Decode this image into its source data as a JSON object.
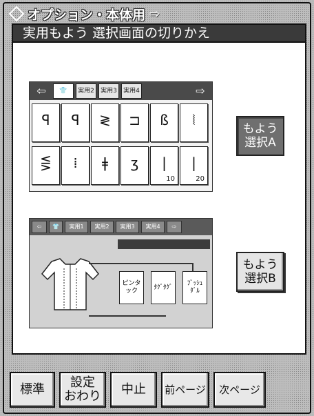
{
  "header": {
    "title": "オプション・本体用",
    "title_arrow_icon": "right-arrow-icon",
    "subtitle": "実用もよう 選択画面の切りかえ"
  },
  "preview_a": {
    "tabs": [
      "",
      "実用2",
      "実用3",
      "実用4"
    ],
    "stitches": [
      {
        "icon": "buttonhole-icon",
        "glyph": "ꟼ"
      },
      {
        "icon": "buttonhole-icon",
        "glyph": "ꟼ"
      },
      {
        "icon": "zigzag-stitch-icon",
        "glyph": "≷"
      },
      {
        "icon": "blind-stitch-icon",
        "glyph": "⊐"
      },
      {
        "icon": "overcast-stitch-icon",
        "glyph": "ß"
      },
      {
        "icon": "triple-zigzag-icon",
        "glyph": "⦚"
      },
      {
        "icon": "scallop-stitch-icon",
        "glyph": "⋚"
      },
      {
        "icon": "dotted-stitch-icon",
        "glyph": "⁞"
      },
      {
        "icon": "bartack-stitch-icon",
        "glyph": "ǂ"
      },
      {
        "icon": "serpentine-stitch-icon",
        "glyph": "ʒ"
      },
      {
        "icon": "straight-stitch-icon",
        "glyph": "|",
        "num": "10"
      },
      {
        "icon": "straight-stitch-icon",
        "glyph": "|",
        "num": "20"
      }
    ]
  },
  "preview_b": {
    "tabs": [
      "実用1",
      "実用2",
      "実用3",
      "実用4"
    ],
    "buttons": [
      "ピンタック",
      "ﾀｸﾞﾀｸﾞ",
      "ﾌﾞｯｼｭ ﾀﾞﾙ"
    ]
  },
  "select_a": {
    "line1": "もよう",
    "line2": "選択A"
  },
  "select_b": {
    "line1": "もよう",
    "line2": "選択B"
  },
  "bottom": {
    "standard": "標準",
    "settings_1": "設定",
    "settings_2": "おわり",
    "cancel": "中止",
    "prev_page": "前ページ",
    "next_page": "次ページ"
  }
}
